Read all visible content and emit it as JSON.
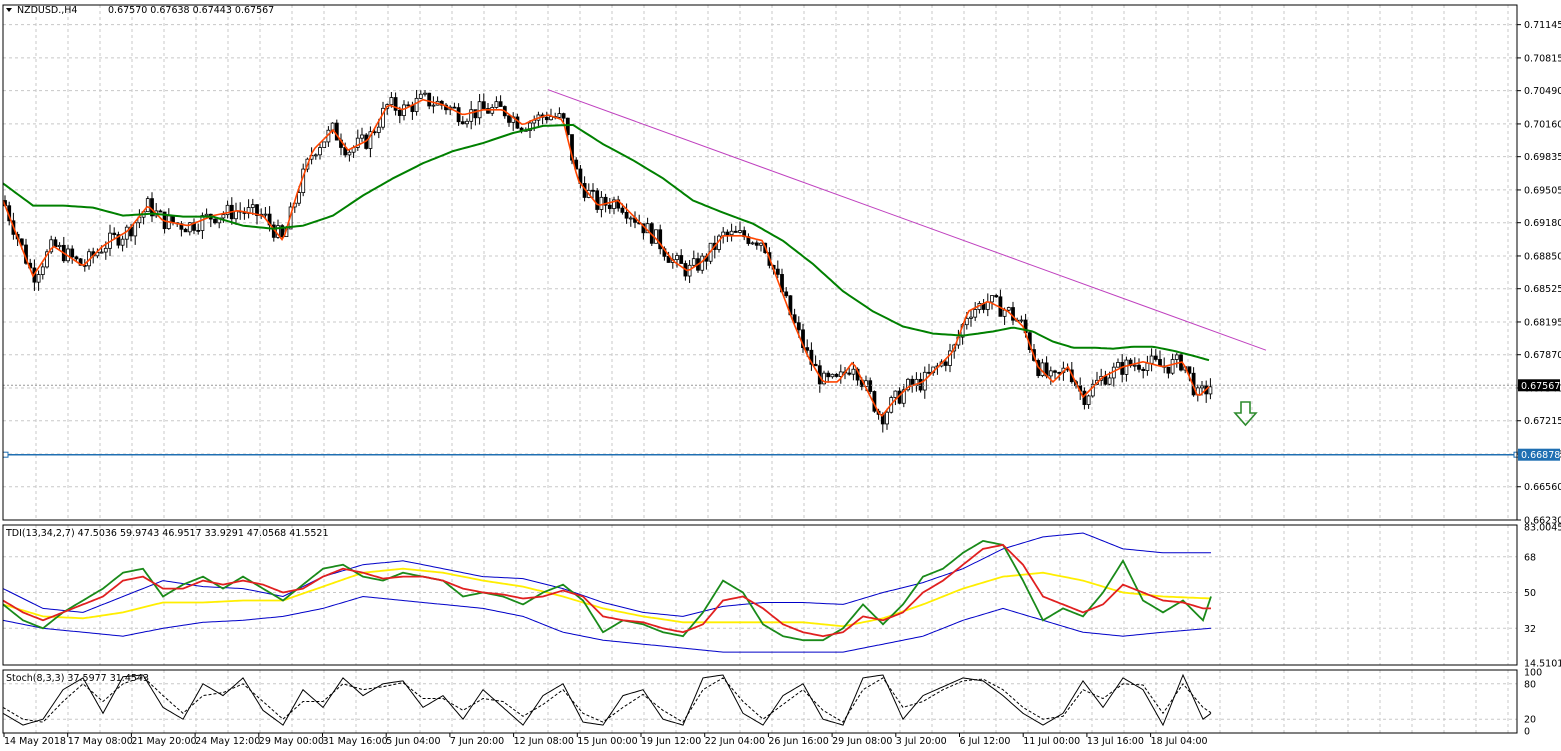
{
  "colors": {
    "background": "#ffffff",
    "grid": "#c8c8c8",
    "frame": "#000000",
    "candle": "#000000",
    "ma_fast": "#ff4500",
    "ma_slow": "#008000",
    "trendline": "#bf40bf",
    "support_line": "#1f6fb2",
    "arrow": "#2e8b2e",
    "tdi_band": "#0000c8",
    "tdi_mid": "#ffee00",
    "tdi_price": "#1a8a1a",
    "tdi_signal": "#e02020",
    "stoch_main": "#000000",
    "stoch_signal": "#000000"
  },
  "icons": {
    "symbol_toggle": "triangle-down-icon",
    "signal_arrow": "down-arrow-icon"
  },
  "chart_data": [
    {
      "type": "candlestick",
      "title": "NZDUSD.,H4",
      "ohlc_header": "0.67570 0.67638 0.67443 0.67567",
      "symbol": "NZDUSD.",
      "timeframe": "H4",
      "open": 0.6757,
      "high": 0.67638,
      "low": 0.67443,
      "close": 0.67567,
      "current_price_label": "0.67567",
      "support_level": 0.66878,
      "support_label": "0.66878",
      "ylim": [
        0.6623,
        0.7134
      ],
      "y_ticks": [
        "0.71145",
        "0.70815",
        "0.70490",
        "0.70160",
        "0.69835",
        "0.69505",
        "0.69180",
        "0.68850",
        "0.68525",
        "0.68195",
        "0.67870",
        "0.67540",
        "0.67215",
        "0.66885",
        "0.66560",
        "0.66230"
      ],
      "x_ticks": [
        "14 May 2018",
        "17 May 08:00",
        "21 May 20:00",
        "24 May 12:00",
        "29 May 00:00",
        "31 May 16:00",
        "5 Jun 04:00",
        "7 Jun 20:00",
        "12 Jun 08:00",
        "15 Jun 00:00",
        "19 Jun 12:00",
        "22 Jun 04:00",
        "26 Jun 16:00",
        "29 Jun 08:00",
        "3 Jul 20:00",
        "6 Jul 12:00",
        "11 Jul 00:00",
        "13 Jul 16:00",
        "18 Jul 04:00"
      ],
      "series": [
        {
          "x": [
            0,
            14,
            30,
            50,
            80,
            100,
            125,
            145,
            160,
            185,
            210,
            235,
            260,
            280,
            295,
            310,
            330,
            345,
            365,
            385,
            400,
            420,
            440,
            460,
            480,
            500,
            520,
            530,
            545,
            560,
            575,
            595,
            615,
            635,
            655,
            670,
            685,
            700,
            720,
            740,
            760,
            775,
            790,
            805,
            820,
            835,
            850,
            865,
            878,
            890,
            905,
            920,
            935,
            950,
            965,
            985,
            1005,
            1020,
            1035,
            1050,
            1065,
            1080,
            1100,
            1120,
            1140,
            1160,
            1180,
            1195,
            1208
          ],
          "y": [
            0.694,
            0.6905,
            0.6865,
            0.6895,
            0.6875,
            0.6895,
            0.691,
            0.6935,
            0.692,
            0.6915,
            0.6925,
            0.693,
            0.6925,
            0.69,
            0.695,
            0.699,
            0.701,
            0.699,
            0.7,
            0.7035,
            0.703,
            0.704,
            0.7035,
            0.7025,
            0.703,
            0.703,
            0.7015,
            0.702,
            0.7025,
            0.702,
            0.696,
            0.6935,
            0.694,
            0.692,
            0.69,
            0.688,
            0.687,
            0.688,
            0.6905,
            0.6905,
            0.69,
            0.686,
            0.682,
            0.6785,
            0.676,
            0.676,
            0.678,
            0.675,
            0.6725,
            0.674,
            0.6755,
            0.676,
            0.6775,
            0.679,
            0.683,
            0.684,
            0.683,
            0.6815,
            0.6775,
            0.676,
            0.6775,
            0.6745,
            0.6765,
            0.6775,
            0.678,
            0.6775,
            0.678,
            0.6745,
            0.6757
          ],
          "name": ""
        },
        {
          "x": [
            0,
            30,
            60,
            90,
            120,
            150,
            180,
            210,
            240,
            270,
            300,
            330,
            360,
            390,
            420,
            450,
            480,
            510,
            540,
            570,
            600,
            630,
            660,
            690,
            720,
            750,
            780,
            810,
            840,
            870,
            900,
            930,
            960,
            990,
            1010,
            1030,
            1050,
            1070,
            1090,
            1110,
            1130,
            1150,
            1170,
            1190,
            1208
          ],
          "y": [
            0.6957,
            0.6935,
            0.6935,
            0.6933,
            0.6925,
            0.6927,
            0.6924,
            0.6924,
            0.6915,
            0.6912,
            0.6915,
            0.6925,
            0.6945,
            0.6962,
            0.6977,
            0.6989,
            0.6997,
            0.7007,
            0.7014,
            0.7015,
            0.6996,
            0.698,
            0.6962,
            0.694,
            0.6928,
            0.6917,
            0.69,
            0.6877,
            0.685,
            0.683,
            0.6815,
            0.6808,
            0.6806,
            0.681,
            0.6814,
            0.681,
            0.68,
            0.6794,
            0.6794,
            0.6793,
            0.6795,
            0.6795,
            0.6791,
            0.6786,
            0.6781
          ],
          "name": ""
        }
      ]
    },
    {
      "type": "line",
      "title": "TDI(13,34,2,7) 47.5036 59.9743 46.9517 33.9291 47.0568 41.5521",
      "ylim": [
        14.5101,
        83.0045
      ],
      "y_ticks": [
        "83.0045",
        "68",
        "50",
        "32",
        "14.5101"
      ],
      "levels": [
        68,
        50,
        32
      ],
      "series": [
        {
          "x": [
            0,
            40,
            80,
            120,
            160,
            200,
            240,
            280,
            320,
            360,
            400,
            440,
            480,
            520,
            560,
            600,
            640,
            680,
            720,
            760,
            800,
            840,
            880,
            920,
            960,
            1000,
            1040,
            1080,
            1120,
            1160,
            1208
          ],
          "y": [
            52,
            42,
            40,
            48,
            56,
            53,
            52,
            48,
            58,
            64,
            66,
            62,
            58,
            57,
            52,
            45,
            40,
            38,
            43,
            45,
            45,
            44,
            50,
            55,
            62,
            72,
            78,
            80,
            72,
            70,
            70
          ]
        },
        {
          "x": [
            0,
            40,
            80,
            120,
            160,
            200,
            240,
            280,
            320,
            360,
            400,
            440,
            480,
            520,
            560,
            600,
            640,
            680,
            720,
            760,
            800,
            840,
            880,
            920,
            960,
            1000,
            1040,
            1080,
            1120,
            1160,
            1208
          ],
          "y": [
            36,
            32,
            30,
            28,
            32,
            35,
            36,
            38,
            42,
            48,
            46,
            44,
            42,
            38,
            30,
            26,
            24,
            22,
            20,
            20,
            20,
            20,
            24,
            28,
            36,
            42,
            36,
            30,
            28,
            30,
            32
          ]
        },
        {
          "x": [
            0,
            40,
            80,
            120,
            160,
            200,
            240,
            280,
            320,
            360,
            400,
            440,
            480,
            520,
            560,
            600,
            640,
            680,
            720,
            760,
            800,
            840,
            880,
            920,
            960,
            1000,
            1040,
            1080,
            1120,
            1160,
            1208
          ],
          "y": [
            44,
            38,
            37,
            40,
            45,
            45,
            46,
            46,
            53,
            60,
            62,
            60,
            56,
            53,
            48,
            42,
            38,
            35,
            35,
            35,
            35,
            33,
            37,
            44,
            52,
            58,
            60,
            56,
            50,
            48,
            47
          ]
        },
        {
          "x": [
            0,
            20,
            40,
            60,
            80,
            100,
            120,
            140,
            160,
            180,
            200,
            220,
            240,
            260,
            280,
            300,
            320,
            340,
            360,
            380,
            400,
            420,
            440,
            460,
            480,
            500,
            520,
            540,
            560,
            580,
            600,
            620,
            640,
            660,
            680,
            700,
            720,
            740,
            760,
            780,
            800,
            820,
            840,
            860,
            880,
            900,
            920,
            940,
            960,
            980,
            1000,
            1020,
            1040,
            1060,
            1080,
            1100,
            1120,
            1140,
            1160,
            1180,
            1200,
            1208
          ],
          "y": [
            44,
            36,
            32,
            40,
            46,
            52,
            60,
            62,
            48,
            54,
            58,
            52,
            58,
            52,
            46,
            54,
            62,
            64,
            58,
            56,
            60,
            58,
            56,
            48,
            50,
            48,
            44,
            50,
            54,
            46,
            30,
            36,
            34,
            30,
            28,
            40,
            56,
            50,
            34,
            28,
            26,
            26,
            32,
            44,
            34,
            44,
            58,
            62,
            70,
            76,
            74,
            56,
            36,
            42,
            38,
            50,
            66,
            46,
            40,
            46,
            36,
            48
          ]
        },
        {
          "x": [
            0,
            20,
            40,
            60,
            80,
            100,
            120,
            140,
            160,
            180,
            200,
            220,
            240,
            260,
            280,
            300,
            320,
            340,
            360,
            380,
            400,
            420,
            440,
            460,
            480,
            500,
            520,
            540,
            560,
            580,
            600,
            620,
            640,
            660,
            680,
            700,
            720,
            740,
            760,
            780,
            800,
            820,
            840,
            860,
            880,
            900,
            920,
            940,
            960,
            980,
            1000,
            1020,
            1040,
            1060,
            1080,
            1100,
            1120,
            1140,
            1160,
            1180,
            1200,
            1208
          ],
          "y": [
            46,
            40,
            36,
            40,
            44,
            48,
            56,
            58,
            52,
            52,
            56,
            54,
            56,
            54,
            50,
            52,
            58,
            62,
            60,
            57,
            58,
            58,
            56,
            52,
            50,
            49,
            47,
            48,
            51,
            48,
            38,
            36,
            35,
            32,
            30,
            34,
            46,
            48,
            42,
            34,
            30,
            28,
            30,
            38,
            36,
            40,
            50,
            56,
            64,
            72,
            74,
            64,
            48,
            44,
            40,
            44,
            54,
            50,
            46,
            45,
            42,
            42
          ]
        }
      ]
    },
    {
      "type": "line",
      "title": "Stoch(8,3,3) 37.5977 31.4543",
      "ylim": [
        0,
        100
      ],
      "y_ticks": [
        "100",
        "80",
        "20",
        "0"
      ],
      "levels": [
        80,
        20
      ],
      "series": [
        {
          "x": [
            0,
            20,
            40,
            60,
            80,
            100,
            120,
            140,
            160,
            180,
            200,
            220,
            240,
            260,
            280,
            300,
            320,
            340,
            360,
            380,
            400,
            420,
            440,
            460,
            480,
            500,
            520,
            540,
            560,
            580,
            600,
            620,
            640,
            660,
            680,
            700,
            720,
            740,
            760,
            780,
            800,
            820,
            840,
            860,
            880,
            900,
            920,
            940,
            960,
            980,
            1000,
            1020,
            1040,
            1060,
            1080,
            1100,
            1120,
            1140,
            1160,
            1180,
            1200,
            1208
          ],
          "y": [
            30,
            10,
            20,
            70,
            90,
            30,
            92,
            95,
            40,
            20,
            80,
            60,
            90,
            35,
            10,
            70,
            40,
            90,
            60,
            80,
            85,
            40,
            60,
            20,
            70,
            40,
            10,
            60,
            80,
            15,
            10,
            60,
            70,
            20,
            10,
            90,
            95,
            30,
            10,
            60,
            80,
            20,
            10,
            90,
            95,
            20,
            60,
            75,
            90,
            85,
            60,
            30,
            10,
            30,
            85,
            40,
            90,
            70,
            10,
            95,
            20,
            30
          ]
        },
        {
          "x": [
            0,
            20,
            40,
            60,
            80,
            100,
            120,
            140,
            160,
            180,
            200,
            220,
            240,
            260,
            280,
            300,
            320,
            340,
            360,
            380,
            400,
            420,
            440,
            460,
            480,
            500,
            520,
            540,
            560,
            580,
            600,
            620,
            640,
            660,
            680,
            700,
            720,
            740,
            760,
            780,
            800,
            820,
            840,
            860,
            880,
            900,
            920,
            940,
            960,
            980,
            1000,
            1020,
            1040,
            1060,
            1080,
            1100,
            1120,
            1140,
            1160,
            1180,
            1200,
            1208
          ],
          "y": [
            40,
            20,
            15,
            50,
            80,
            50,
            80,
            92,
            60,
            30,
            60,
            65,
            80,
            50,
            20,
            50,
            50,
            80,
            70,
            75,
            82,
            55,
            55,
            35,
            55,
            50,
            25,
            45,
            70,
            30,
            15,
            40,
            62,
            35,
            15,
            70,
            90,
            50,
            20,
            45,
            70,
            35,
            15,
            70,
            90,
            40,
            50,
            70,
            85,
            88,
            70,
            40,
            20,
            25,
            70,
            55,
            80,
            78,
            30,
            80,
            40,
            31
          ]
        }
      ]
    }
  ]
}
